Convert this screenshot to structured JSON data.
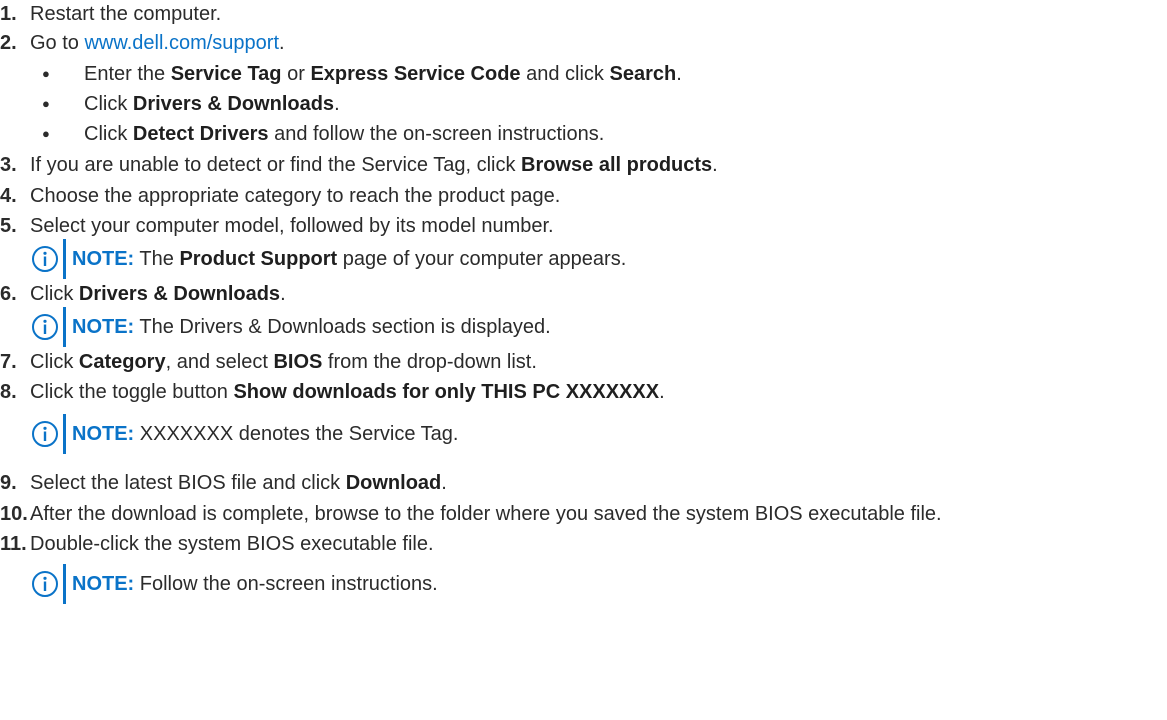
{
  "steps": [
    {
      "num": "1.",
      "text": "Restart the computer."
    },
    {
      "num": "2.",
      "pre": "Go to ",
      "link": "www.dell.com/support",
      "post": "."
    },
    {
      "num": "3.",
      "pre": "If you are unable to detect or find the Service Tag, click ",
      "b1": "Browse all products",
      "post": "."
    },
    {
      "num": "4.",
      "text": "Choose the appropriate category to reach the product page."
    },
    {
      "num": "5.",
      "text": "Select your computer model, followed by its model number."
    },
    {
      "num": "6.",
      "pre": "Click ",
      "b1": "Drivers & Downloads",
      "post": "."
    },
    {
      "num": "7.",
      "pre": "Click ",
      "b1": "Category",
      "mid": ", and select ",
      "b2": "BIOS",
      "post": " from the drop-down list."
    },
    {
      "num": "8.",
      "pre": "Click the toggle button ",
      "b1": "Show downloads for only THIS PC XXXXXXX",
      "post": "."
    },
    {
      "num": "9.",
      "pre": "Select the latest BIOS file and click ",
      "b1": "Download",
      "post": "."
    },
    {
      "num": "10.",
      "text": "After the download is complete, browse to the folder where you saved the system BIOS executable file."
    },
    {
      "num": "11.",
      "text": "Double-click the system BIOS executable file."
    }
  ],
  "bullets": [
    {
      "pre": "Enter the ",
      "b1": "Service Tag",
      "mid": " or ",
      "b2": "Express Service Code",
      "mid2": " and click ",
      "b3": "Search",
      "post": "."
    },
    {
      "pre": "Click ",
      "b1": "Drivers & Downloads",
      "post": "."
    },
    {
      "pre": "Click ",
      "b1": "Detect Drivers",
      "post": " and follow the on-screen instructions."
    }
  ],
  "bullet_glyph": "●",
  "notes": [
    {
      "label": "NOTE:",
      "pre": " The ",
      "b1": "Product Support",
      "post": " page of your computer appears."
    },
    {
      "label": "NOTE:",
      "text": " The Drivers & Downloads section is displayed."
    },
    {
      "label": "NOTE:",
      "text": " XXXXXXX denotes the Service Tag."
    },
    {
      "label": "NOTE:",
      "text": " Follow the on-screen instructions."
    }
  ],
  "colors": {
    "accent": "#0a73c8",
    "text": "#2b2b2b"
  },
  "note_icon": "info-circle-icon"
}
